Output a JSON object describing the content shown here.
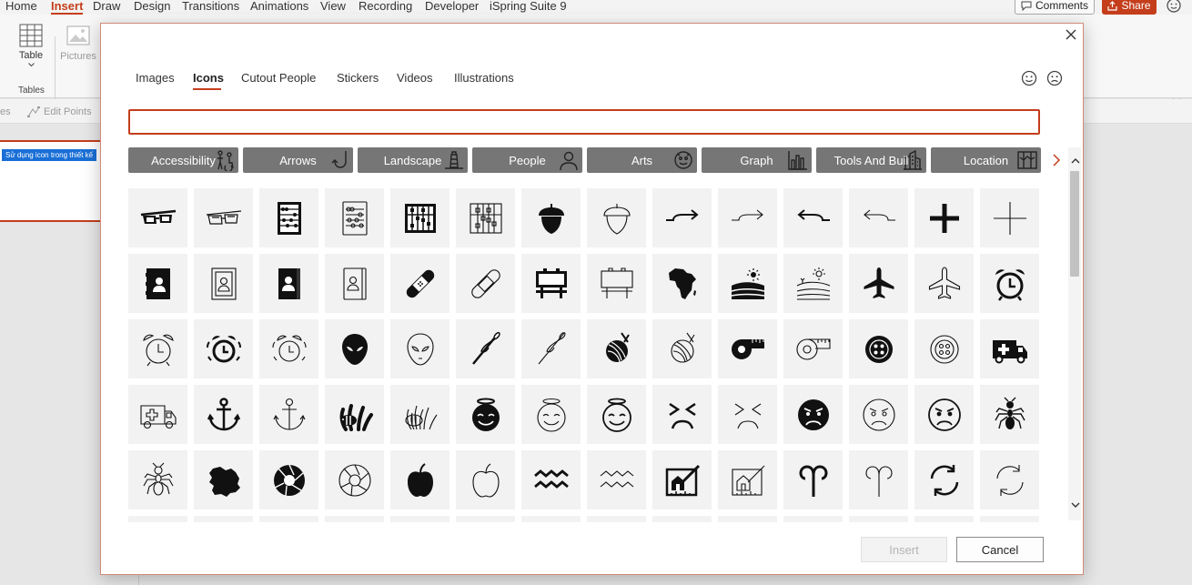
{
  "ribbon": {
    "tabs": [
      "Home",
      "Insert",
      "Draw",
      "Design",
      "Transitions",
      "Animations",
      "View",
      "Recording",
      "Developer",
      "iSpring Suite 9"
    ],
    "active_tab": "Insert",
    "comments_label": "Comments",
    "share_label": "Share",
    "table_label": "Table",
    "pictures_label": "Pictures",
    "group_tables_label": "Tables",
    "edit_points_label": "Edit Points",
    "shapes_partial_label": "es"
  },
  "slide": {
    "tag_text": "Sử dụng icon trong thiết kế"
  },
  "dialog": {
    "tabs": [
      "Images",
      "Icons",
      "Cutout People",
      "Stickers",
      "Videos",
      "Illustrations"
    ],
    "active_tab": "Icons",
    "search": {
      "value": "",
      "placeholder": ""
    },
    "categories": [
      {
        "label": "Accessibility",
        "icon": "accessibility-icon"
      },
      {
        "label": "Arrows",
        "icon": "arrow-icon"
      },
      {
        "label": "Landscape",
        "icon": "lighthouse-icon"
      },
      {
        "label": "People",
        "icon": "person-icon"
      },
      {
        "label": "Arts",
        "icon": "mask-icon"
      },
      {
        "label": "Graph",
        "icon": "bar-graph-icon"
      },
      {
        "label": "Tools And Buil",
        "icon": "building-icon"
      },
      {
        "label": "Location",
        "icon": "map-icon"
      }
    ],
    "icons": [
      "3d-glasses-icon",
      "3d-glasses-outline-icon",
      "abacus-icon",
      "abacus-outline-icon",
      "abacus-frame-icon",
      "abacus-frame-outline-icon",
      "acorn-icon",
      "acorn-outline-icon",
      "turn-right-arrow-icon",
      "turn-right-arrow-outline-icon",
      "turn-left-arrow-icon",
      "turn-left-arrow-outline-icon",
      "plus-icon",
      "plus-outline-icon",
      "address-book-icon",
      "address-book-outline-icon",
      "contact-book-icon",
      "contact-book-outline-icon",
      "bandage-icon",
      "bandage-outline-icon",
      "billboard-icon",
      "billboard-outline-icon",
      "africa-icon",
      "farm-field-icon",
      "farm-field-outline-icon",
      "airplane-icon",
      "airplane-outline-icon",
      "alarm-clock-icon",
      "alarm-clock-outline-icon",
      "alarm-ringing-icon",
      "alarm-ringing-outline-icon",
      "alien-icon",
      "alien-outline-icon",
      "knitting-needle-icon",
      "knitting-needle-outline-icon",
      "yarn-ball-icon",
      "yarn-ball-outline-icon",
      "measuring-tape-icon",
      "measuring-tape-outline-icon",
      "button-icon",
      "button-outline-icon",
      "ambulance-icon",
      "ambulance-outline-icon",
      "anchor-icon",
      "anchor-outline-icon",
      "anemone-fish-icon",
      "anemone-fish-outline-icon",
      "angel-face-icon",
      "angel-face-outline-icon",
      "angel-face-outline-2-icon",
      "angry-face-icon",
      "angry-face-outline-icon",
      "frowning-face-icon",
      "frowning-face-outline-icon",
      "frowning-face-outline-2-icon",
      "ant-icon",
      "ant-outline-icon",
      "antarctica-icon",
      "aperture-icon",
      "aperture-outline-icon",
      "apple-icon",
      "apple-outline-icon",
      "aquarius-icon",
      "aquarius-outline-icon",
      "architecture-icon",
      "architecture-outline-icon",
      "aries-icon",
      "aries-outline-icon",
      "arrow-circle-icon",
      "arrow-circle-outline-icon"
    ],
    "insert_label": "Insert",
    "cancel_label": "Cancel"
  }
}
